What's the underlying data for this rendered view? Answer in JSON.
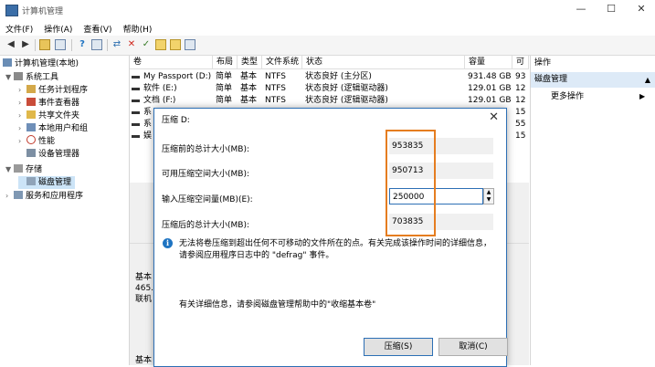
{
  "window": {
    "title": "计算机管理",
    "minimize": "—",
    "maximize": "☐",
    "close": "✕"
  },
  "menu": [
    "文件(F)",
    "操作(A)",
    "查看(V)",
    "帮助(H)"
  ],
  "tree": {
    "root": "计算机管理(本地)",
    "system_tools": "系统工具",
    "task_scheduler": "任务计划程序",
    "event_viewer": "事件查看器",
    "shared_folders": "共享文件夹",
    "local_users": "本地用户和组",
    "performance": "性能",
    "device_manager": "设备管理器",
    "storage": "存储",
    "disk_management": "磁盘管理",
    "services_apps": "服务和应用程序"
  },
  "volume_list": {
    "headers": [
      "卷",
      "布局",
      "类型",
      "文件系统",
      "状态",
      "容量",
      "可"
    ],
    "rows": [
      {
        "name": "My Passport (D:)",
        "layout": "简单",
        "type": "基本",
        "fs": "NTFS",
        "status": "状态良好 (主分区)",
        "capacity": "931.48 GB",
        "free": "93"
      },
      {
        "name": "软件 (E:)",
        "layout": "简单",
        "type": "基本",
        "fs": "NTFS",
        "status": "状态良好 (逻辑驱动器)",
        "capacity": "129.01 GB",
        "free": "12"
      },
      {
        "name": "文档 (F:)",
        "layout": "简单",
        "type": "基本",
        "fs": "NTFS",
        "status": "状态良好 (逻辑驱动器)",
        "capacity": "129.01 GB",
        "free": "12"
      },
      {
        "name": "系",
        "layout": "",
        "type": "",
        "fs": "",
        "status": "",
        "capacity": "",
        "free": "15"
      },
      {
        "name": "系",
        "layout": "",
        "type": "",
        "fs": "",
        "status": "",
        "capacity": "",
        "free": "55"
      },
      {
        "name": "娱",
        "layout": "",
        "type": "",
        "fs": "",
        "status": "",
        "capacity": "",
        "free": "15"
      }
    ]
  },
  "lower_disk": {
    "line1": "基本",
    "line2": "465.",
    "line3": "联机",
    "line4": "基本"
  },
  "actions": {
    "header": "操作",
    "section": "磁盘管理",
    "more": "更多操作"
  },
  "dialog": {
    "title": "压缩 D:",
    "fields": [
      {
        "label": "压缩前的总计大小(MB):",
        "value": "953835"
      },
      {
        "label": "可用压缩空间大小(MB):",
        "value": "950713"
      },
      {
        "label": "输入压缩空间量(MB)(E):",
        "value": "250000"
      },
      {
        "label": "压缩后的总计大小(MB):",
        "value": "703835"
      }
    ],
    "info": "无法将卷压缩到超出任何不可移动的文件所在的点。有关完成该操作时间的详细信息，请参阅应用程序日志中的 \"defrag\" 事件。",
    "help": "有关详细信息，请参阅磁盘管理帮助中的\"收缩基本卷\"",
    "buttons": {
      "shrink": "压缩(S)",
      "cancel": "取消(C)"
    }
  },
  "colors": {
    "accent": "#2c6fb5",
    "highlight_box": "#e57d20",
    "selection": "#cce4f7"
  }
}
